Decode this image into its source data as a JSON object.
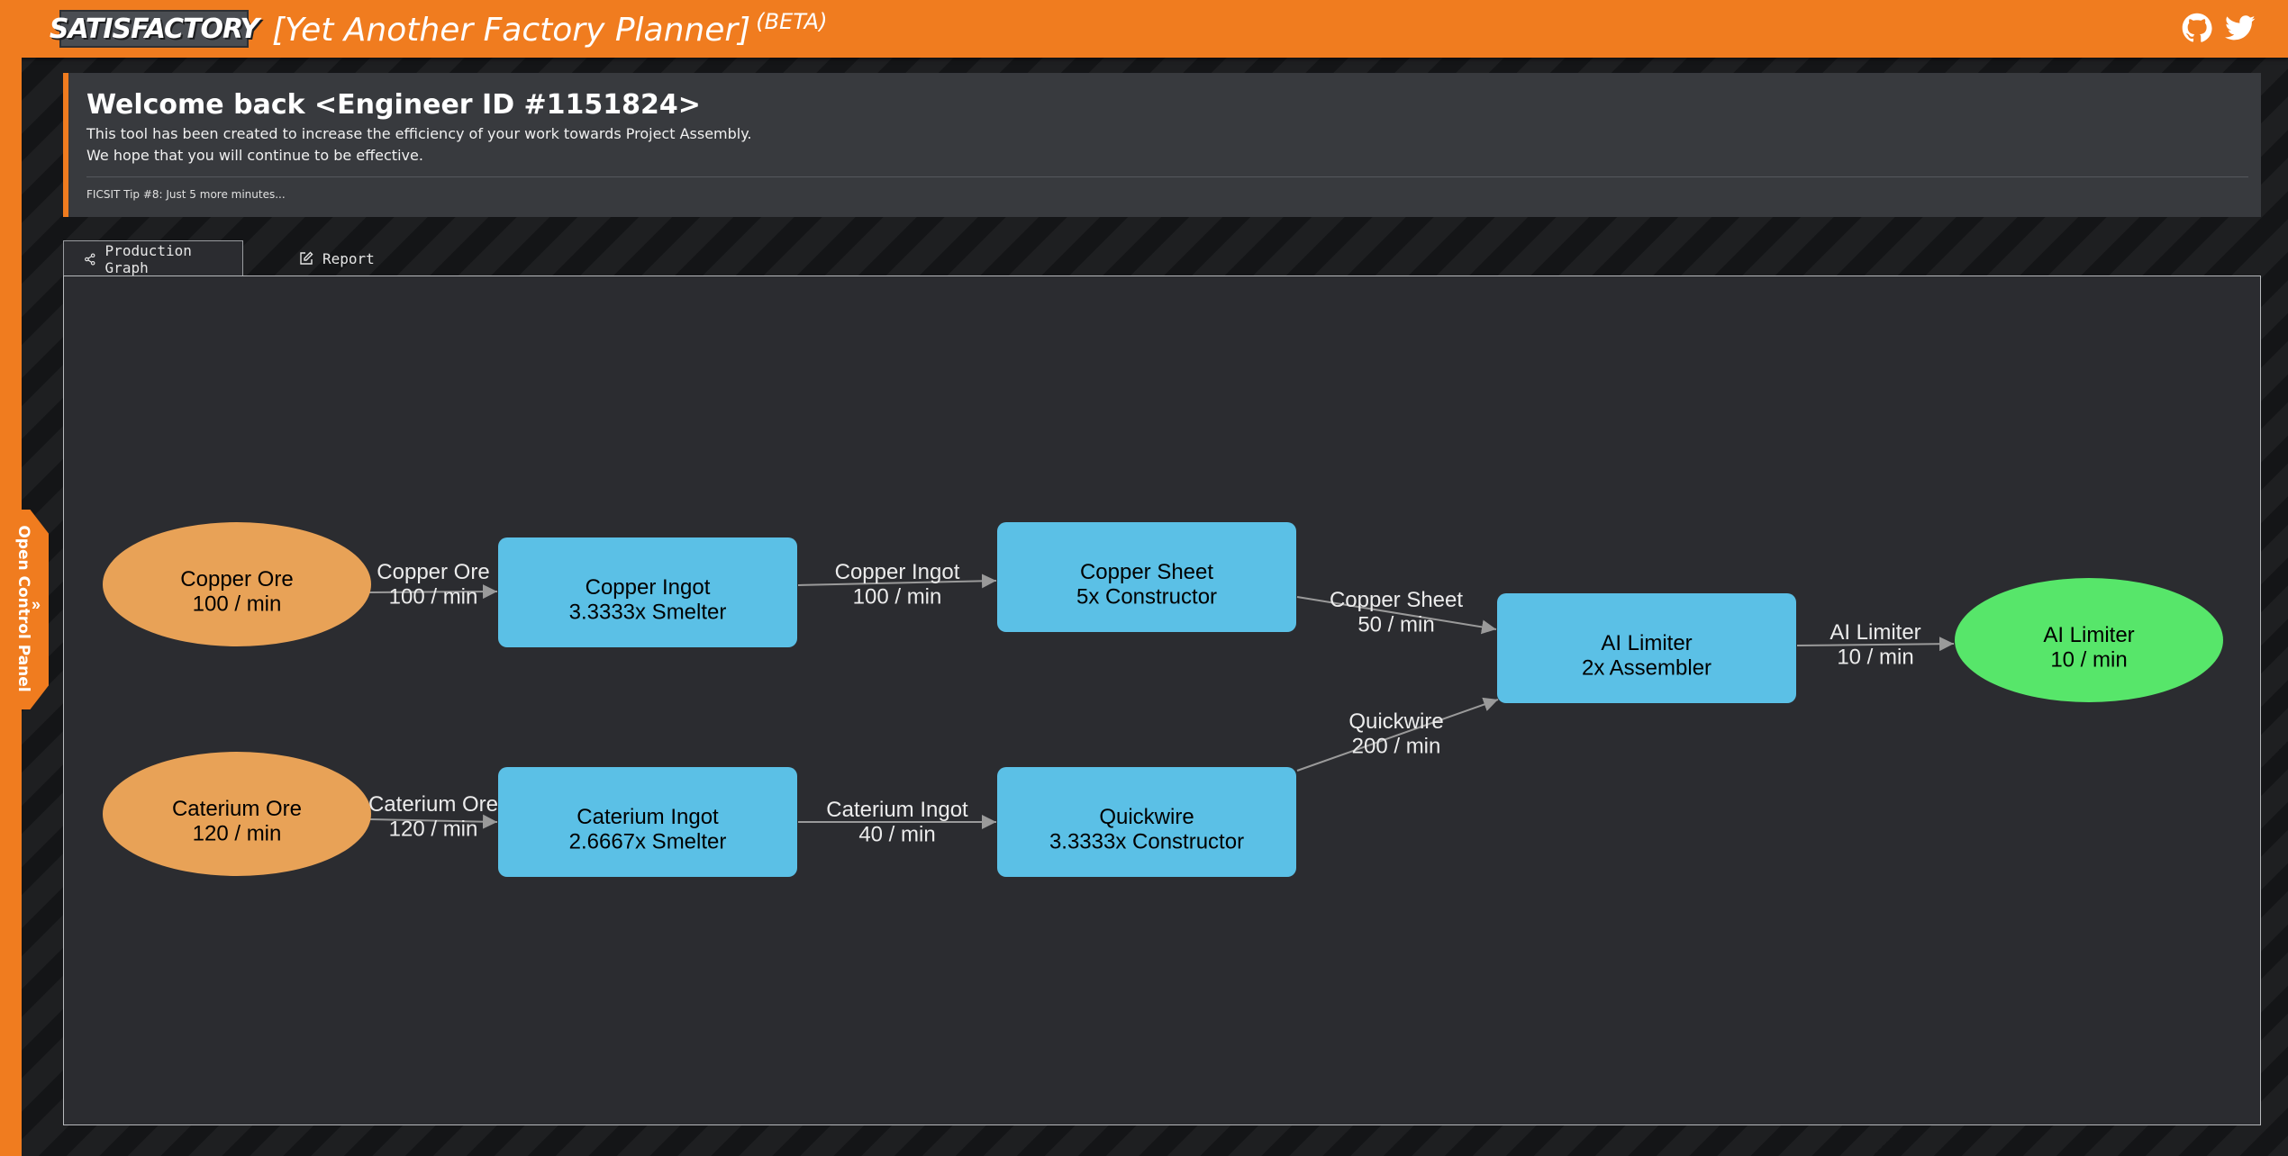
{
  "header": {
    "logo_text": "SATISFACTORY",
    "app_title": "[Yet Another Factory Planner]",
    "beta": "(BETA)",
    "icons": [
      "github-icon",
      "twitter-icon"
    ],
    "accent_color": "#f07c1f"
  },
  "sidebar": {
    "label": "Open Control Panel",
    "icon": "double-chevron-right-icon"
  },
  "welcome": {
    "title": "Welcome back <Engineer ID #1151824>",
    "line1": "This tool has been created to increase the efficiency of your work towards Project Assembly.",
    "line2": "We hope that you will continue to be effective.",
    "tip": "FICSIT Tip #8: Just 5 more minutes..."
  },
  "tabs": [
    {
      "label": "Production Graph",
      "icon": "share-graph-icon",
      "active": true
    },
    {
      "label": "Report",
      "icon": "edit-icon",
      "active": false
    }
  ],
  "graph": {
    "colors": {
      "resource": "#e8a257",
      "recipe": "#5bc0e6",
      "product": "#57e66a",
      "edge": "#9a9a9a"
    },
    "nodes": [
      {
        "id": "copper_ore",
        "kind": "resource",
        "line1": "Copper Ore",
        "line2": "100 / min"
      },
      {
        "id": "copper_ingot",
        "kind": "recipe",
        "line1": "Copper Ingot",
        "line2": "3.3333x Smelter"
      },
      {
        "id": "copper_sheet",
        "kind": "recipe",
        "line1": "Copper Sheet",
        "line2": "5x Constructor"
      },
      {
        "id": "ai_limiter",
        "kind": "recipe",
        "line1": "AI Limiter",
        "line2": "2x Assembler"
      },
      {
        "id": "ai_limiter_out",
        "kind": "product",
        "line1": "AI Limiter",
        "line2": "10 / min"
      },
      {
        "id": "caterium_ore",
        "kind": "resource",
        "line1": "Caterium Ore",
        "line2": "120 / min"
      },
      {
        "id": "caterium_ingot",
        "kind": "recipe",
        "line1": "Caterium Ingot",
        "line2": "2.6667x Smelter"
      },
      {
        "id": "quickwire",
        "kind": "recipe",
        "line1": "Quickwire",
        "line2": "3.3333x Constructor"
      }
    ],
    "edges": [
      {
        "from": "copper_ore",
        "to": "copper_ingot",
        "line1": "Copper Ore",
        "line2": "100 / min"
      },
      {
        "from": "copper_ingot",
        "to": "copper_sheet",
        "line1": "Copper Ingot",
        "line2": "100 / min"
      },
      {
        "from": "copper_sheet",
        "to": "ai_limiter",
        "line1": "Copper Sheet",
        "line2": "50 / min"
      },
      {
        "from": "ai_limiter",
        "to": "ai_limiter_out",
        "line1": "AI Limiter",
        "line2": "10 / min"
      },
      {
        "from": "caterium_ore",
        "to": "caterium_ingot",
        "line1": "Caterium Ore",
        "line2": "120 / min"
      },
      {
        "from": "caterium_ingot",
        "to": "quickwire",
        "line1": "Caterium Ingot",
        "line2": "40 / min"
      },
      {
        "from": "quickwire",
        "to": "ai_limiter",
        "line1": "Quickwire",
        "line2": "200 / min"
      }
    ]
  }
}
